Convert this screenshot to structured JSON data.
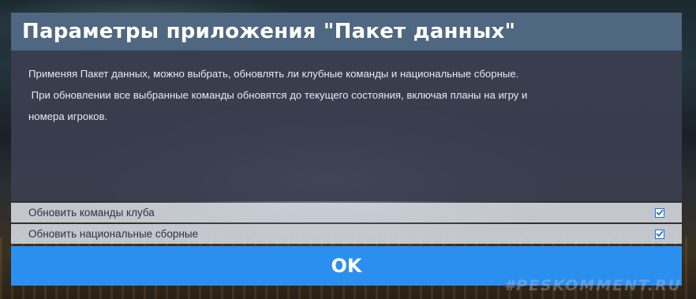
{
  "dialog": {
    "title": "Параметры приложения \"Пакет данных\"",
    "description_line1": "Применяя Пакет данных, можно выбрать, обновлять ли клубные команды и национальные сборные.",
    "description_line2": " При обновлении все выбранные команды обновятся до текущего состояния, включая планы на игру и",
    "description_line3": "номера игроков.",
    "options": [
      {
        "label": "Обновить команды клуба",
        "checked": true
      },
      {
        "label": "Обновить национальные сборные",
        "checked": true
      }
    ],
    "ok_label": "OK"
  },
  "watermark": "#PESKOMMENT.RU",
  "colors": {
    "title_bar": "#4f6780",
    "ok_button": "#2b8ff0",
    "checkbox_accent": "#1f6fd6"
  },
  "icons": {
    "checkbox": "checkmark-icon"
  }
}
